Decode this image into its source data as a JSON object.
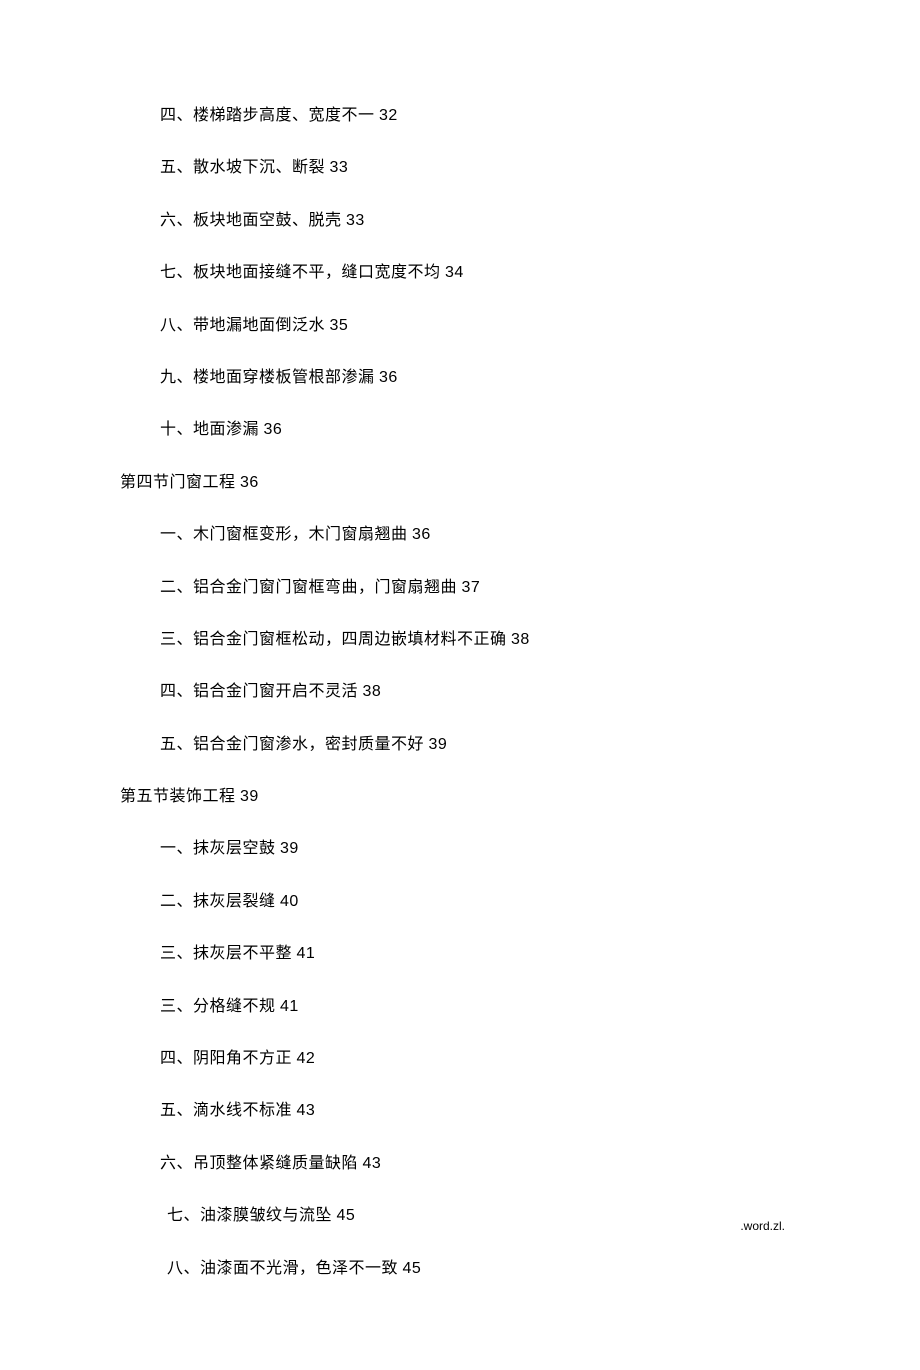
{
  "toc": {
    "group1": [
      {
        "text": "四、楼梯踏步高度、宽度不一 ",
        "page": "32",
        "indent": "indent-sub"
      },
      {
        "text": "五、散水坡下沉、断裂 ",
        "page": "33",
        "indent": "indent-sub"
      },
      {
        "text": "六、板块地面空鼓、脱壳 ",
        "page": "33",
        "indent": "indent-sub"
      },
      {
        "text": "七、板块地面接缝不平，缝口宽度不均 ",
        "page": "34",
        "indent": "indent-sub"
      },
      {
        "text": "八、带地漏地面倒泛水 ",
        "page": "35",
        "indent": "indent-sub"
      },
      {
        "text": "九、楼地面穿楼板管根部渗漏 ",
        "page": "36",
        "indent": "indent-sub"
      },
      {
        "text": "十、地面渗漏 ",
        "page": "36",
        "indent": "indent-sub"
      }
    ],
    "section4": {
      "text": "第四节门窗工程 ",
      "page": "36",
      "indent": "indent-section"
    },
    "group2": [
      {
        "text": "一、木门窗框变形，木门窗扇翘曲 ",
        "page": "36",
        "indent": "indent-sub"
      },
      {
        "text": "二、铝合金门窗门窗框弯曲，门窗扇翘曲 ",
        "page": "37",
        "indent": "indent-sub"
      },
      {
        "text": "三、铝合金门窗框松动，四周边嵌填材料不正确 ",
        "page": "38",
        "indent": "indent-sub"
      },
      {
        "text": "四、铝合金门窗开启不灵活 ",
        "page": "38",
        "indent": "indent-sub"
      },
      {
        "text": "五、铝合金门窗渗水，密封质量不好 ",
        "page": "39",
        "indent": "indent-sub"
      }
    ],
    "section5": {
      "text": "第五节装饰工程 ",
      "page": "39",
      "indent": "indent-section"
    },
    "group3": [
      {
        "text": "一、抹灰层空鼓 ",
        "page": "39",
        "indent": "indent-sub"
      },
      {
        "text": "二、抹灰层裂缝 ",
        "page": "40",
        "indent": "indent-sub"
      },
      {
        "text": "三、抹灰层不平整 ",
        "page": "41",
        "indent": "indent-sub"
      },
      {
        "text": "三、分格缝不规 ",
        "page": "41",
        "indent": "indent-sub"
      },
      {
        "text": "四、阴阳角不方正 ",
        "page": "42",
        "indent": "indent-sub"
      },
      {
        "text": "五、滴水线不标准 ",
        "page": "43",
        "indent": "indent-sub"
      },
      {
        "text": "六、吊顶整体紧缝质量缺陷 ",
        "page": "43",
        "indent": "indent-sub"
      },
      {
        "text": "七、油漆膜皱纹与流坠 ",
        "page": "45",
        "indent": "indent-sub-alt"
      },
      {
        "text": "八、油漆面不光滑，色泽不一致 ",
        "page": "45",
        "indent": "indent-sub-alt"
      }
    ]
  },
  "footer": ".word.zl."
}
